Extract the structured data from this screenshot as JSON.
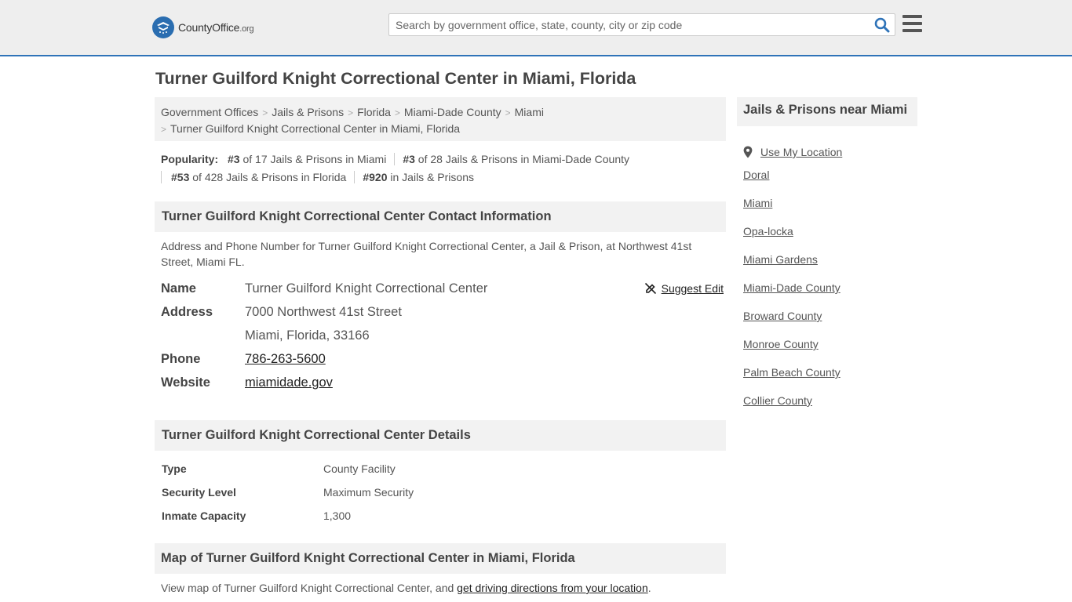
{
  "header": {
    "logo_name": "CountyOffice",
    "logo_tld": ".org",
    "search_placeholder": "Search by government office, state, county, city or zip code"
  },
  "page_title": "Turner Guilford Knight Correctional Center in Miami, Florida",
  "breadcrumb": {
    "items": [
      "Government Offices",
      "Jails & Prisons",
      "Florida",
      "Miami-Dade County",
      "Miami"
    ],
    "current": "Turner Guilford Knight Correctional Center in Miami, Florida"
  },
  "popularity": {
    "label": "Popularity:",
    "items": [
      {
        "rank": "#3",
        "text": " of 17 Jails & Prisons in Miami"
      },
      {
        "rank": "#3",
        "text": " of 28 Jails & Prisons in Miami-Dade County"
      },
      {
        "rank": "#53",
        "text": " of 428 Jails & Prisons in Florida"
      },
      {
        "rank": "#920",
        "text": " in Jails & Prisons"
      }
    ]
  },
  "contact": {
    "heading": "Turner Guilford Knight Correctional Center Contact Information",
    "description": "Address and Phone Number for Turner Guilford Knight Correctional Center, a Jail & Prison, at Northwest 41st Street, Miami FL.",
    "suggest_edit": "Suggest Edit",
    "name_label": "Name",
    "name": "Turner Guilford Knight Correctional Center",
    "address_label": "Address",
    "address_line1": "7000 Northwest 41st Street",
    "address_line2": "Miami, Florida, 33166",
    "phone_label": "Phone",
    "phone": "786-263-5600",
    "website_label": "Website",
    "website": "miamidade.gov"
  },
  "details": {
    "heading": "Turner Guilford Knight Correctional Center Details",
    "rows": [
      {
        "label": "Type",
        "value": "County Facility"
      },
      {
        "label": "Security Level",
        "value": "Maximum Security"
      },
      {
        "label": "Inmate Capacity",
        "value": "1,300"
      }
    ]
  },
  "map": {
    "heading": "Map of Turner Guilford Knight Correctional Center in Miami, Florida",
    "text": "View map of Turner Guilford Knight Correctional Center, and ",
    "link": "get driving directions from your location",
    "end": "."
  },
  "sidebar": {
    "heading": "Jails & Prisons near Miami",
    "use_location": "Use My Location",
    "links": [
      "Doral",
      "Miami",
      "Opa-locka",
      "Miami Gardens",
      "Miami-Dade County",
      "Broward County",
      "Monroe County",
      "Palm Beach County",
      "Collier County"
    ]
  },
  "colors": {
    "accent": "#2f73b8",
    "topbar_bg": "#eeeeee",
    "panel_bg": "#f2f2f2",
    "text": "#555555",
    "heading": "#444444"
  }
}
